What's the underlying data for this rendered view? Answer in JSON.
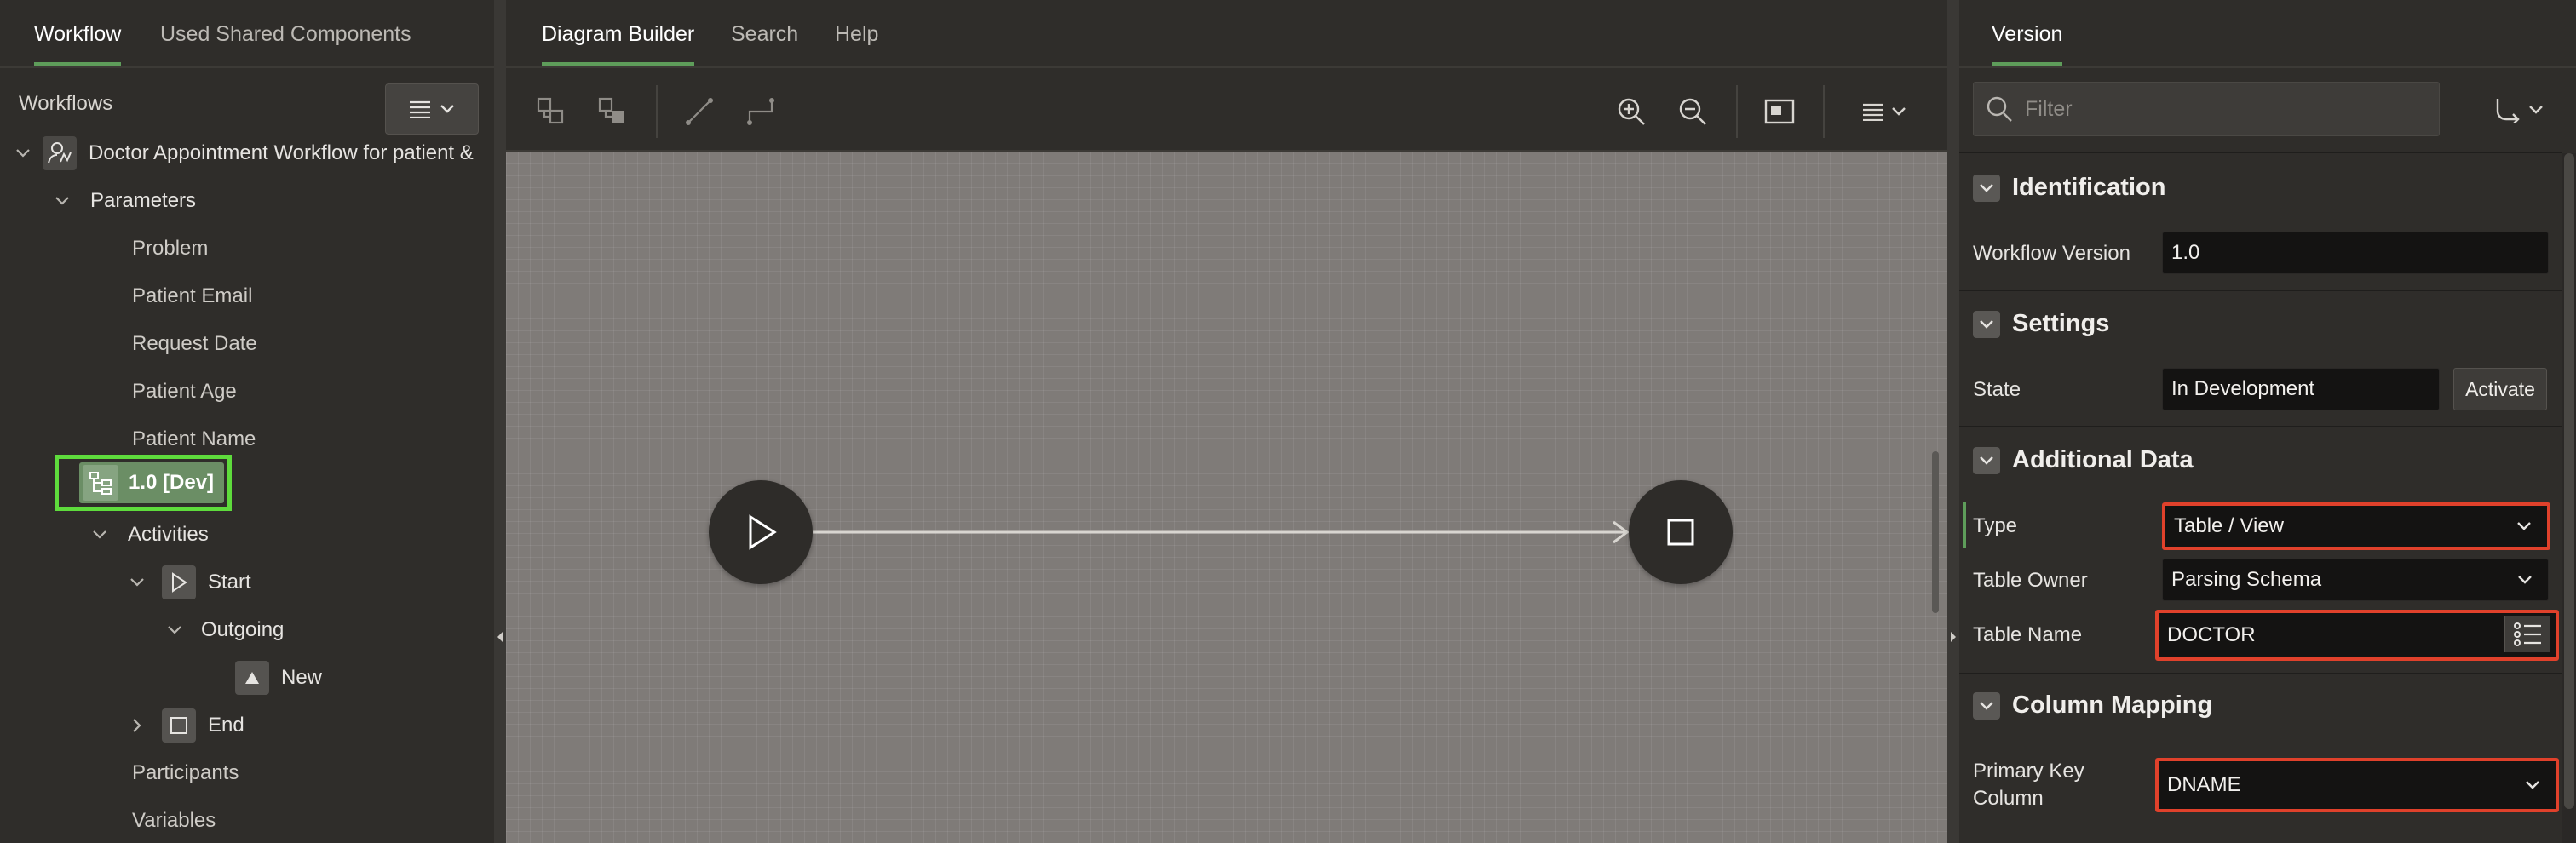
{
  "left_panel": {
    "tabs": [
      {
        "label": "Workflow",
        "active": true
      },
      {
        "label": "Used Shared Components",
        "active": false
      }
    ],
    "section_title": "Workflows",
    "tree": {
      "workflow_name": "Doctor Appointment Workflow for patient &",
      "parameters_label": "Parameters",
      "parameters": [
        "Problem",
        "Patient Email",
        "Request Date",
        "Patient Age",
        "Patient Name"
      ],
      "version_label": "1.0 [Dev]",
      "activities_label": "Activities",
      "start_label": "Start",
      "outgoing_label": "Outgoing",
      "new_label": "New",
      "end_label": "End",
      "participants_label": "Participants",
      "variables_label": "Variables"
    }
  },
  "center_panel": {
    "tabs": [
      {
        "label": "Diagram Builder",
        "active": true
      },
      {
        "label": "Search",
        "active": false
      },
      {
        "label": "Help",
        "active": false
      }
    ],
    "toolbar_icons": [
      "expand-all-icon",
      "collapse-all-icon",
      "straight-connector-icon",
      "orthogonal-connector-icon",
      "zoom-in-icon",
      "zoom-out-icon",
      "fit-to-screen-icon",
      "menu-icon"
    ],
    "diagram": {
      "nodes": [
        "start",
        "end"
      ],
      "connection": "start-to-end"
    }
  },
  "right_panel": {
    "tab": "Version",
    "filter_placeholder": "Filter",
    "sections": {
      "identification": {
        "title": "Identification",
        "workflow_version_label": "Workflow Version",
        "workflow_version_value": "1.0"
      },
      "settings": {
        "title": "Settings",
        "state_label": "State",
        "state_value": "In Development",
        "activate_label": "Activate"
      },
      "additional_data": {
        "title": "Additional Data",
        "type_label": "Type",
        "type_value": "Table / View",
        "table_owner_label": "Table Owner",
        "table_owner_value": "Parsing Schema",
        "table_name_label": "Table Name",
        "table_name_value": "DOCTOR"
      },
      "column_mapping": {
        "title": "Column Mapping",
        "primary_key_label_line1": "Primary Key",
        "primary_key_label_line2": "Column",
        "primary_key_value": "DNAME"
      }
    }
  },
  "colors": {
    "accent_green": "#5e9d5a",
    "selection_highlight": "#5edb3c",
    "annotation_red": "#e0412b"
  }
}
